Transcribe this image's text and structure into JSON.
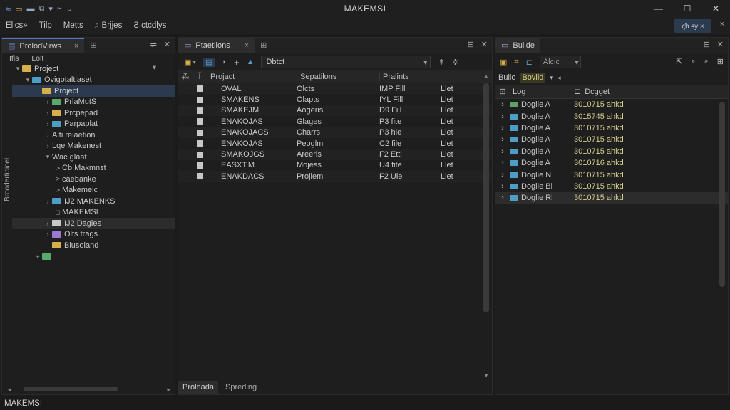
{
  "window": {
    "title": "MAKEMSI",
    "controls": [
      "—",
      "☐",
      "✕"
    ]
  },
  "quick_access": [
    "≈",
    "▭",
    "▬",
    "⧉",
    "▾",
    "~",
    "⌄"
  ],
  "menu": {
    "items": [
      "Elics»",
      "Tilp",
      "Metts",
      "⌕ Brjjes",
      "Ƨ ctcdlys"
    ],
    "right_label": "ꞔƅ ꞩɏ ×",
    "right_extra": "×"
  },
  "left_panel": {
    "tab": "ProlodVirws",
    "tab_close": "×",
    "tab_pin": "⊞",
    "controls": [
      "⇌",
      "✕"
    ],
    "sub_label": "Ifis",
    "sub_label2": "Lolt",
    "sub_dropdown": "▾",
    "vertical_label": "Broodertioicel",
    "tree": [
      {
        "indent": 0,
        "chev": "▾",
        "icon": "fy",
        "label": "Project",
        "state": ""
      },
      {
        "indent": 1,
        "chev": "▾",
        "icon": "fb",
        "label": "Ovigotaltiaset",
        "state": ""
      },
      {
        "indent": 2,
        "chev": "",
        "icon": "fy",
        "label": "Project",
        "state": "sel"
      },
      {
        "indent": 3,
        "chev": "›",
        "icon": "fg",
        "label": "PrlaMutS",
        "state": ""
      },
      {
        "indent": 3,
        "chev": "›",
        "icon": "fy",
        "label": "Prcpepad",
        "state": ""
      },
      {
        "indent": 3,
        "chev": "›",
        "icon": "fb",
        "label": "Parpaplat",
        "state": ""
      },
      {
        "indent": 3,
        "chev": "›",
        "icon": "",
        "label": "Alti reiaetion",
        "state": ""
      },
      {
        "indent": 3,
        "chev": "›",
        "icon": "",
        "label": "Lqe Makenest",
        "state": ""
      },
      {
        "indent": 3,
        "chev": "▾",
        "icon": "",
        "label": "Wac glaat",
        "state": ""
      },
      {
        "indent": 4,
        "chev": "⊳",
        "icon": "",
        "label": "Cb Makmnst",
        "state": ""
      },
      {
        "indent": 4,
        "chev": "⊳",
        "icon": "",
        "label": "caebanke",
        "state": ""
      },
      {
        "indent": 4,
        "chev": "⊳",
        "icon": "",
        "label": "Makemeic",
        "state": ""
      },
      {
        "indent": 3,
        "chev": "›",
        "icon": "fb",
        "label": "IJ2 MAKENKS",
        "state": ""
      },
      {
        "indent": 4,
        "chev": "◻",
        "icon": "",
        "label": "MAKEMSI",
        "state": ""
      },
      {
        "indent": 3,
        "chev": "›",
        "icon": "fw",
        "label": "IJ2 Dagles",
        "state": "hl"
      },
      {
        "indent": 3,
        "chev": "›",
        "icon": "fp",
        "label": "Olts trags",
        "state": ""
      },
      {
        "indent": 3,
        "chev": "",
        "icon": "fy",
        "label": "Biusoland",
        "state": ""
      },
      {
        "indent": 2,
        "chev": "⚹",
        "icon": "fg",
        "label": "",
        "state": ""
      }
    ]
  },
  "mid_panel": {
    "tab": "Ptaetlions",
    "tab_close": "×",
    "tab_pin": "⊞",
    "controls": [
      "⊟",
      "✕"
    ],
    "toolbar_icons": [
      "▣",
      "▾",
      "▤",
      "◗",
      "+",
      "▲"
    ],
    "search_value": "Dbtct",
    "search_drop": "▾",
    "tool_right": [
      "⇞",
      "✲"
    ],
    "headers": [
      "Projact",
      "Sepatilons",
      "Pralints"
    ],
    "header_sort": [
      "⁂",
      "Ï"
    ],
    "rows": [
      [
        "OVAL",
        "Olcts",
        "IMP Fill",
        "Llet"
      ],
      [
        "SMAKENS",
        "Olapts",
        "IYL Fill",
        "Llet"
      ],
      [
        "SMAKEJM",
        "Aogeris",
        "D9 Fill",
        "Llet"
      ],
      [
        "ENAKOJAS",
        "Glages",
        "P3 fite",
        "Llet"
      ],
      [
        "ENAKOJACS",
        "Charrs",
        "P3 hle",
        "Llet"
      ],
      [
        "ENAKOJAS",
        "Peoglm",
        "C2 file",
        "Llet"
      ],
      [
        "SMAKOJGS",
        "Areeris",
        "F2 Ettl",
        "Llet"
      ],
      [
        "EASXT.M",
        "Mojess",
        "U4 fite",
        "Llet"
      ],
      [
        "ENAKDACS",
        "Projlem",
        "F2 Ule",
        "Llet"
      ]
    ],
    "bottom_tabs": [
      "Prolnada",
      "Spreding"
    ]
  },
  "right_panel": {
    "tab": "Builde",
    "controls": [
      "⊟",
      "✕"
    ],
    "toolbar_icons": [
      "▣",
      "⌗",
      "⊏"
    ],
    "search_value": "Alcic",
    "search_drop": "▾",
    "tool_right": [
      "⇱",
      "⌕",
      "⌕",
      "⊞"
    ],
    "subbar_label": "Builo",
    "subbar_badge": "Bovild",
    "subbar_dropdown": "▾",
    "subbar_marker": "◂",
    "headers": [
      "Log",
      "Dcgget"
    ],
    "header_icons": [
      "⊡",
      "⊏"
    ],
    "rows": [
      {
        "name": "Doglie A",
        "value": "3010715 ahkd",
        "color": "#5ea06a"
      },
      {
        "name": "Doglie A",
        "value": "3015745 ahkd",
        "color": "#4d9ec6"
      },
      {
        "name": "Doglie A",
        "value": "3010715 ahkd",
        "color": "#4d9ec6"
      },
      {
        "name": "Doglie A",
        "value": "3010715 ahkd",
        "color": "#4d9ec6"
      },
      {
        "name": "Doglie A",
        "value": "3010715 ahkd",
        "color": "#4d9ec6"
      },
      {
        "name": "Doglie A",
        "value": "3010716 ahkd",
        "color": "#4d9ec6"
      },
      {
        "name": "Doglie N",
        "value": "3010715 ahkd",
        "color": "#4d9ec6"
      },
      {
        "name": "Doglie Bl",
        "value": "3010715 ahkd",
        "color": "#4d9ec6"
      },
      {
        "name": "Doglie Rl",
        "value": "3010715 ahkd",
        "color": "#4d9ec6"
      }
    ]
  },
  "status": {
    "text": "MAKEMSI"
  },
  "colors": {
    "accent": "#2b3a4f",
    "bg": "#1e1e1e",
    "value_text": "#d6cf8e"
  }
}
